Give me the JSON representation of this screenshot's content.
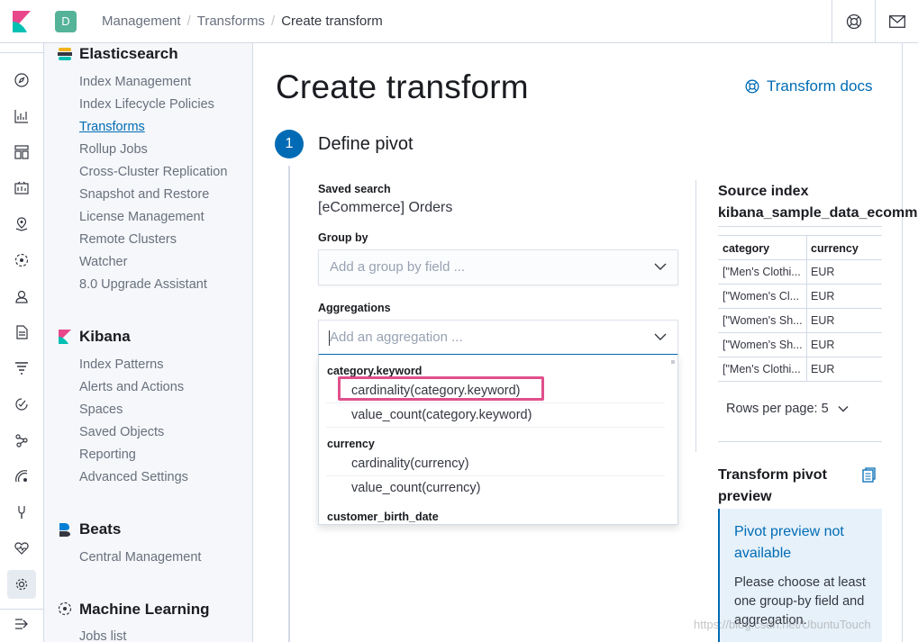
{
  "header": {
    "avatar_letter": "D",
    "breadcrumbs": [
      "Management",
      "Transforms",
      "Create transform"
    ]
  },
  "nav_icons": [
    "compass-icon",
    "chart-icon",
    "dashboard-icon",
    "canvas-icon",
    "maps-icon",
    "ml-icon",
    "user-icon",
    "logs-icon",
    "apm-icon",
    "uptime-icon",
    "graph-icon",
    "siem-icon",
    "devtools-icon",
    "monitoring-icon",
    "gear-icon",
    "collapse-icon"
  ],
  "sidebar": {
    "sections": [
      {
        "title": "Elasticsearch",
        "items": [
          "Index Management",
          "Index Lifecycle Policies",
          "Transforms",
          "Rollup Jobs",
          "Cross-Cluster Replication",
          "Snapshot and Restore",
          "License Management",
          "Remote Clusters",
          "Watcher",
          "8.0 Upgrade Assistant"
        ]
      },
      {
        "title": "Kibana",
        "items": [
          "Index Patterns",
          "Alerts and Actions",
          "Spaces",
          "Saved Objects",
          "Reporting",
          "Advanced Settings"
        ]
      },
      {
        "title": "Beats",
        "items": [
          "Central Management"
        ]
      },
      {
        "title": "Machine Learning",
        "items": [
          "Jobs list"
        ]
      }
    ],
    "active_item": "Transforms"
  },
  "main": {
    "title": "Create transform",
    "docs_link": "Transform docs",
    "step_number": "1",
    "step_title": "Define pivot",
    "saved_search_label": "Saved search",
    "saved_search_value": "[eCommerce] Orders",
    "group_by_label": "Group by",
    "group_by_placeholder": "Add a group by field ...",
    "aggregations_label": "Aggregations",
    "aggregations_placeholder": "Add an aggregation ...",
    "dropdown": {
      "groups": [
        {
          "name": "category.keyword",
          "options": [
            "cardinality(category.keyword)",
            "value_count(category.keyword)"
          ]
        },
        {
          "name": "currency",
          "options": [
            "cardinality(currency)",
            "value_count(currency)"
          ]
        },
        {
          "name": "customer_birth_date",
          "options": []
        }
      ],
      "highlighted_option": "cardinality(category.keyword)"
    }
  },
  "source": {
    "title": "Source index",
    "index_name": "kibana_sample_data_ecommerce",
    "columns": [
      "category",
      "currency"
    ],
    "rows": [
      [
        "[\"Men's Clothi...",
        "EUR"
      ],
      [
        "[\"Women's Cl...",
        "EUR"
      ],
      [
        "[\"Women's Sh...",
        "EUR"
      ],
      [
        "[\"Women's Sh...",
        "EUR"
      ],
      [
        "[\"Men's Clothi...",
        "EUR"
      ]
    ],
    "rows_per_page": "Rows per page: 5"
  },
  "preview": {
    "title": "Transform pivot preview",
    "callout_title": "Pivot preview not available",
    "callout_body": "Please choose at least one group-by field and aggregation."
  },
  "watermark": "https://blog.csdn.net/UbuntuTouch",
  "colors": {
    "accent": "#006bb4",
    "highlight": "#e0508c",
    "sidebar_bg": "#f5f7fa"
  }
}
